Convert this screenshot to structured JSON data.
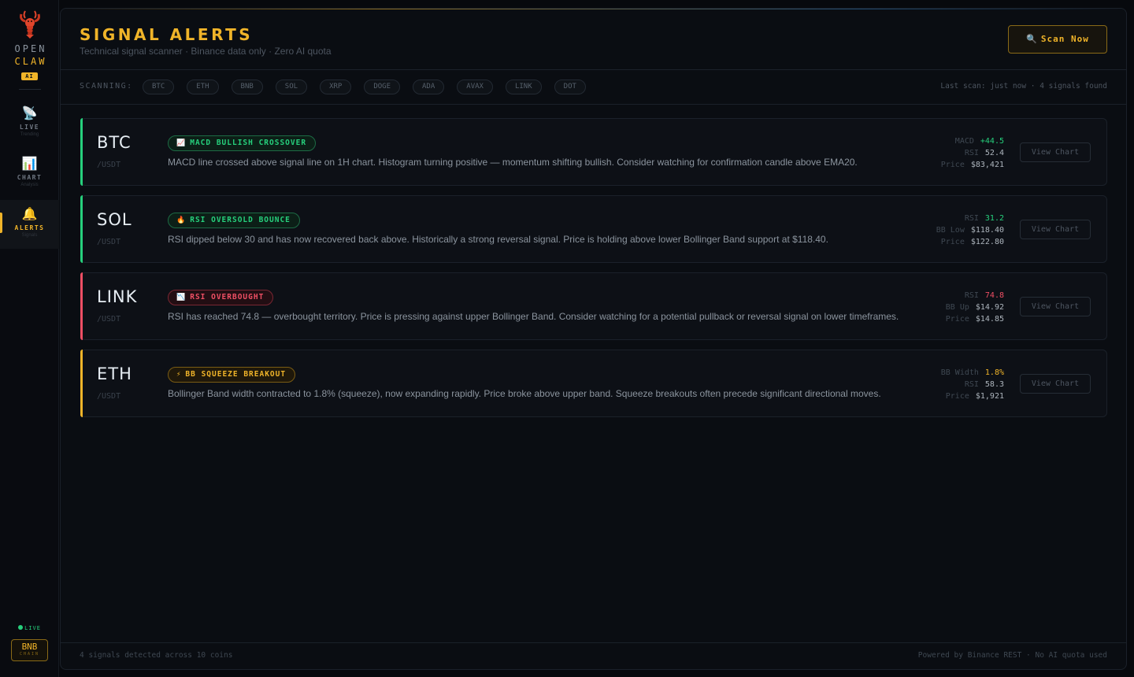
{
  "brand": {
    "line1": "OPEN",
    "line2": "CLAW",
    "badge": "AI",
    "logo_icon": "lobster-icon"
  },
  "nav": {
    "items": [
      {
        "label": "LIVE",
        "sub": "Trending",
        "icon": "satellite-dish-icon",
        "glyph": "📡",
        "active": false
      },
      {
        "label": "CHART",
        "sub": "Analysis",
        "icon": "bar-chart-icon",
        "glyph": "📊",
        "active": false
      },
      {
        "label": "ALERTS",
        "sub": "Signals",
        "icon": "bell-icon",
        "glyph": "🔔",
        "active": true
      }
    ]
  },
  "status": {
    "live_label": "LIVE"
  },
  "chain": {
    "main": "BNB",
    "sub": "CHAIN"
  },
  "header": {
    "title": "SIGNAL ALERTS",
    "subtitle": "Technical signal scanner · Binance data only · Zero AI quota",
    "scan_button": {
      "icon": "search-icon",
      "glyph": "🔍",
      "label": "Scan Now"
    }
  },
  "scanbar": {
    "label": "SCANNING:",
    "coins": [
      "BTC",
      "ETH",
      "BNB",
      "SOL",
      "XRP",
      "DOGE",
      "ADA",
      "AVAX",
      "LINK",
      "DOT"
    ],
    "status": "Last scan: just now · 4 signals found"
  },
  "colors": {
    "accent": "#f0b429",
    "bullish": "#26d07c",
    "bearish": "#ef4f64",
    "squeeze": "#f0b429"
  },
  "signals": [
    {
      "symbol": "BTC",
      "quote": "/USDT",
      "tone": "bullish",
      "tag_icon": "chart-up-icon",
      "tag_glyph": "📈",
      "tag": "MACD BULLISH CROSSOVER",
      "description": "MACD line crossed above signal line on 1H chart. Histogram turning positive — momentum shifting bullish. Consider watching for confirmation candle above EMA20.",
      "metrics": [
        {
          "label": "MACD",
          "value": "+44.5",
          "tone": "bullish"
        },
        {
          "label": "RSI",
          "value": "52.4",
          "tone": "neutral"
        },
        {
          "label": "Price",
          "value": "$83,421",
          "tone": "neutral"
        }
      ],
      "action": "View Chart"
    },
    {
      "symbol": "SOL",
      "quote": "/USDT",
      "tone": "bullish",
      "tag_icon": "fire-icon",
      "tag_glyph": "🔥",
      "tag": "RSI OVERSOLD BOUNCE",
      "description": "RSI dipped below 30 and has now recovered back above. Historically a strong reversal signal. Price is holding above lower Bollinger Band support at $118.40.",
      "metrics": [
        {
          "label": "RSI",
          "value": "31.2",
          "tone": "bullish"
        },
        {
          "label": "BB Low",
          "value": "$118.40",
          "tone": "neutral"
        },
        {
          "label": "Price",
          "value": "$122.80",
          "tone": "neutral"
        }
      ],
      "action": "View Chart"
    },
    {
      "symbol": "LINK",
      "quote": "/USDT",
      "tone": "bearish",
      "tag_icon": "chart-down-icon",
      "tag_glyph": "📉",
      "tag": "RSI OVERBOUGHT",
      "description": "RSI has reached 74.8 — overbought territory. Price is pressing against upper Bollinger Band. Consider watching for a potential pullback or reversal signal on lower timeframes.",
      "metrics": [
        {
          "label": "RSI",
          "value": "74.8",
          "tone": "bearish"
        },
        {
          "label": "BB Up",
          "value": "$14.92",
          "tone": "neutral"
        },
        {
          "label": "Price",
          "value": "$14.85",
          "tone": "neutral"
        }
      ],
      "action": "View Chart"
    },
    {
      "symbol": "ETH",
      "quote": "/USDT",
      "tone": "squeeze",
      "tag_icon": "lightning-icon",
      "tag_glyph": "⚡",
      "tag": "BB SQUEEZE BREAKOUT",
      "description": "Bollinger Band width contracted to 1.8% (squeeze), now expanding rapidly. Price broke above upper band. Squeeze breakouts often precede significant directional moves.",
      "metrics": [
        {
          "label": "BB Width",
          "value": "1.8%",
          "tone": "squeeze"
        },
        {
          "label": "RSI",
          "value": "58.3",
          "tone": "neutral"
        },
        {
          "label": "Price",
          "value": "$1,921",
          "tone": "neutral"
        }
      ],
      "action": "View Chart"
    }
  ],
  "footer": {
    "left": "4 signals detected across 10 coins",
    "right": "Powered by Binance REST · No AI quota used"
  }
}
